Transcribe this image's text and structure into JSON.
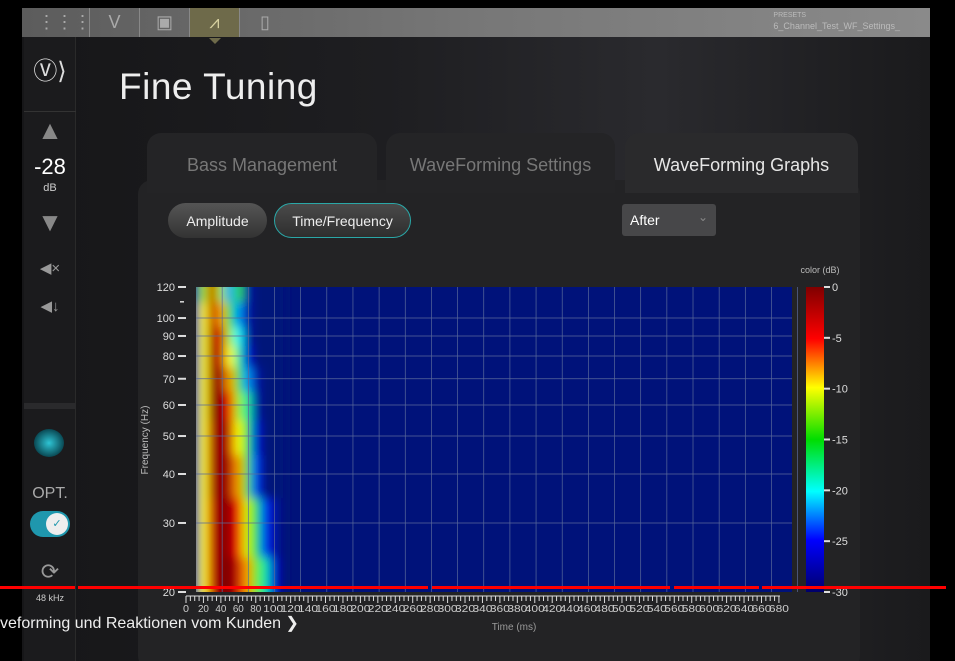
{
  "topbar": {
    "icons": [
      "grid-icon",
      "check-logo-icon",
      "box-icon",
      "graph-icon",
      "mic-icon"
    ],
    "preset_label": "PRESETS",
    "preset_name": "6_Channel_Test_WF_Settings_"
  },
  "sidebar": {
    "volume": "-28",
    "volume_unit": "dB",
    "input": "OPT.",
    "sample_rate": "48 kHz"
  },
  "page_title": "Fine Tuning",
  "tabs": [
    {
      "label": "Bass Management"
    },
    {
      "label": "WaveForming Settings"
    },
    {
      "label": "WaveForming Graphs",
      "active": true
    }
  ],
  "graph_buttons": [
    {
      "label": "Amplitude"
    },
    {
      "label": "Time/Frequency",
      "active": true
    }
  ],
  "view_select": {
    "value": "After"
  },
  "chart_data": {
    "type": "heatmap",
    "xlabel": "Time (ms)",
    "ylabel": "Frequency (Hz)",
    "colorbar_label": "color (dB)",
    "xlim": [
      0,
      695
    ],
    "ylim": [
      20,
      120
    ],
    "yscale": "log",
    "x_ticks": [
      0,
      20,
      40,
      60,
      80,
      100,
      120,
      140,
      160,
      180,
      200,
      220,
      240,
      260,
      280,
      300,
      320,
      340,
      360,
      380,
      400,
      420,
      440,
      460,
      480,
      500,
      520,
      540,
      560,
      580,
      600,
      620,
      640,
      660,
      680
    ],
    "y_ticks": [
      20,
      30,
      40,
      50,
      60,
      70,
      80,
      90,
      100,
      120
    ],
    "colorbar_ticks": [
      0,
      -5,
      -10,
      -15,
      -20,
      -25,
      -30
    ],
    "clim": [
      -30,
      0
    ],
    "times": [
      0,
      10,
      20,
      30,
      40,
      50,
      60,
      70,
      80,
      90,
      100
    ],
    "frequencies": [
      120,
      100,
      90,
      80,
      70,
      60,
      50,
      40,
      30,
      20
    ],
    "values_db": [
      [
        -28,
        -12,
        -3,
        -12,
        -22,
        -14,
        -28,
        -30,
        -30,
        -30,
        -30
      ],
      [
        -28,
        -10,
        -2,
        -8,
        -16,
        -22,
        -28,
        -30,
        -30,
        -30,
        -30
      ],
      [
        -28,
        -10,
        -1,
        -4,
        -12,
        -20,
        -28,
        -30,
        -30,
        -30,
        -30
      ],
      [
        -28,
        -10,
        -1,
        -3,
        -10,
        -18,
        -26,
        -30,
        -30,
        -30,
        -30
      ],
      [
        -28,
        -10,
        -1,
        -1,
        -8,
        -14,
        -22,
        -28,
        -30,
        -30,
        -30
      ],
      [
        -28,
        -10,
        -1,
        0,
        -5,
        -12,
        -18,
        -28,
        -30,
        -30,
        -30
      ],
      [
        -28,
        -10,
        -2,
        0,
        -3,
        -10,
        -16,
        -26,
        -30,
        -30,
        -30
      ],
      [
        -28,
        -10,
        -2,
        0,
        -2,
        -8,
        -14,
        -24,
        -30,
        -30,
        -30
      ],
      [
        -28,
        -10,
        -3,
        0,
        -1,
        -5,
        -11,
        -16,
        -24,
        -28,
        -30
      ],
      [
        -28,
        -10,
        -3,
        0,
        0,
        -3,
        -8,
        -13,
        -18,
        -26,
        -30
      ]
    ]
  },
  "video": {
    "chapter_title": "veforming und Reaktionen vom Kunden"
  }
}
